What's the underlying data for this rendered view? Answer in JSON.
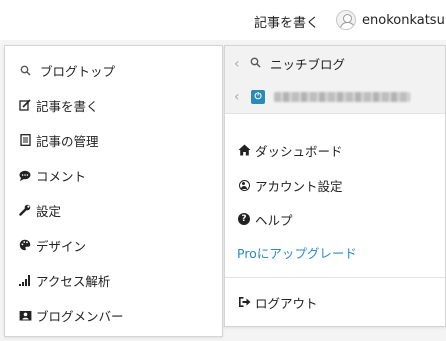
{
  "header": {
    "write_label": "記事を書く",
    "username": "enokonkatsu",
    "caret": "▾"
  },
  "left_menu": {
    "items": [
      {
        "label": "ブログトップ",
        "icon": "search-icon"
      },
      {
        "label": "記事を書く",
        "icon": "edit-icon"
      },
      {
        "label": "記事の管理",
        "icon": "document-icon"
      },
      {
        "label": "コメント",
        "icon": "comment-icon"
      },
      {
        "label": "設定",
        "icon": "wrench-icon"
      },
      {
        "label": "デザイン",
        "icon": "palette-icon"
      },
      {
        "label": "アクセス解析",
        "icon": "bar-chart-icon"
      },
      {
        "label": "ブログメンバー",
        "icon": "members-icon"
      }
    ]
  },
  "right_menu": {
    "niche_label": "ニッチブログ",
    "items": [
      {
        "label": "ダッシュボード",
        "icon": "home-icon"
      },
      {
        "label": "アカウント設定",
        "icon": "user-circle-icon"
      },
      {
        "label": "ヘルプ",
        "icon": "question-icon"
      },
      {
        "label": "Proにアップグレード",
        "icon": ""
      }
    ],
    "logout_label": "ログアウト"
  },
  "colors": {
    "pro_link": "#2a8bc7",
    "blog_icon": "#2a8bb5"
  }
}
